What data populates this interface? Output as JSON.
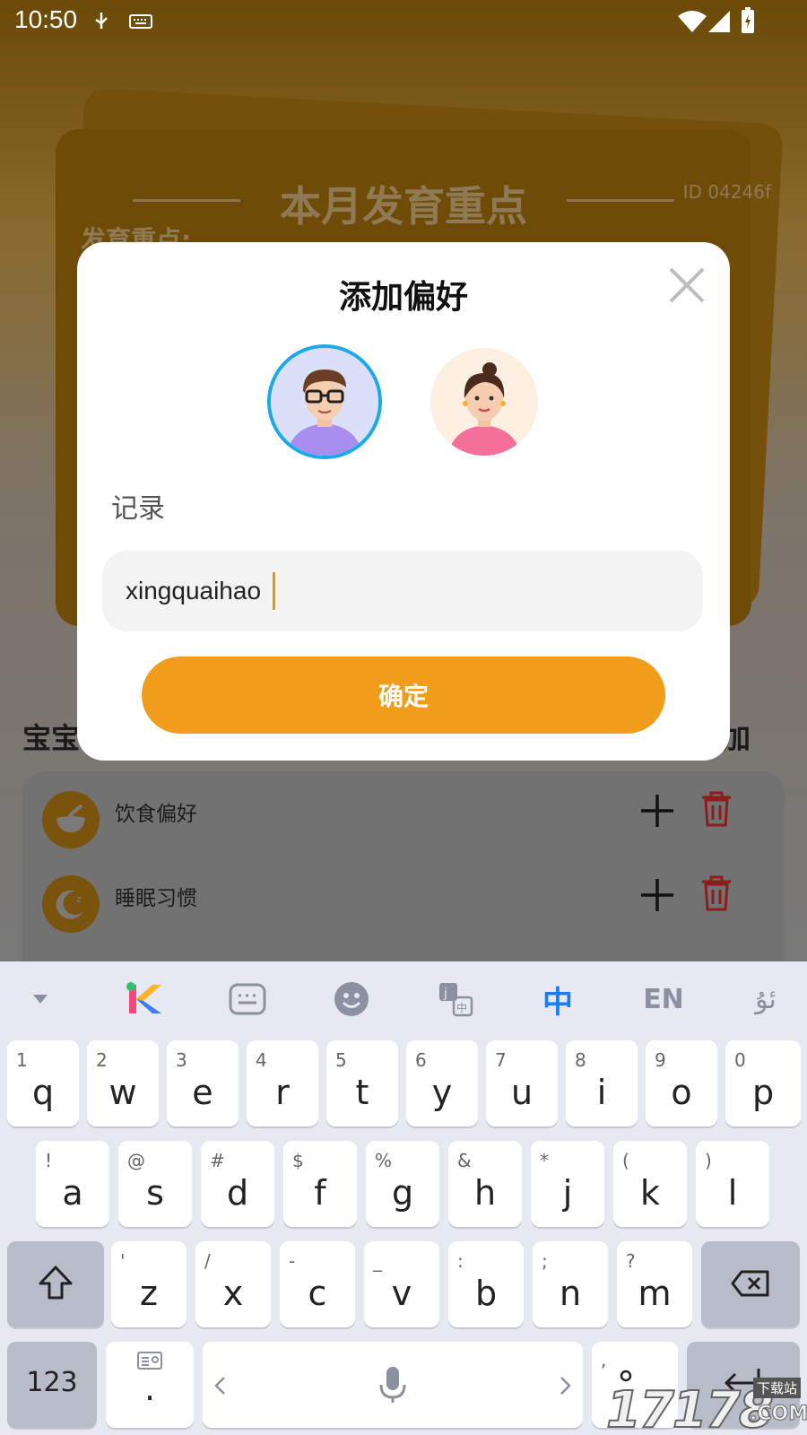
{
  "status_bar": {
    "time": "10:50"
  },
  "background": {
    "card_title": "本月发育重点",
    "card_subtitle": "发育重点:",
    "card_id": "ID 04246f",
    "section_left": "宝宝",
    "section_right": "加",
    "preferences": [
      {
        "label": "饮食偏好",
        "icon": "bowl-icon"
      },
      {
        "label": "睡眠习惯",
        "icon": "moon-icon"
      }
    ]
  },
  "dialog": {
    "title": "添加偏好",
    "avatars": [
      {
        "name": "male-avatar",
        "selected": true
      },
      {
        "name": "female-avatar",
        "selected": false
      }
    ],
    "field_label": "记录",
    "input_value": "xingquaihao",
    "confirm_label": "确定"
  },
  "keyboard": {
    "toolbar": [
      "collapse-icon",
      "kika-logo-icon",
      "keyboard-layout-icon",
      "emoji-icon",
      "translate-icon",
      "中",
      "EN",
      "ئۇ"
    ],
    "row1": [
      {
        "main": "q",
        "sub": "1"
      },
      {
        "main": "w",
        "sub": "2"
      },
      {
        "main": "e",
        "sub": "3"
      },
      {
        "main": "r",
        "sub": "4"
      },
      {
        "main": "t",
        "sub": "5"
      },
      {
        "main": "y",
        "sub": "6"
      },
      {
        "main": "u",
        "sub": "7"
      },
      {
        "main": "i",
        "sub": "8"
      },
      {
        "main": "o",
        "sub": "9"
      },
      {
        "main": "p",
        "sub": "0"
      }
    ],
    "row2": [
      {
        "main": "a",
        "sub": "!"
      },
      {
        "main": "s",
        "sub": "@"
      },
      {
        "main": "d",
        "sub": "#"
      },
      {
        "main": "f",
        "sub": "$"
      },
      {
        "main": "g",
        "sub": "%"
      },
      {
        "main": "h",
        "sub": "&"
      },
      {
        "main": "j",
        "sub": "*"
      },
      {
        "main": "k",
        "sub": "("
      },
      {
        "main": "l",
        "sub": ")"
      }
    ],
    "row3": [
      {
        "main": "z",
        "sub": "'"
      },
      {
        "main": "x",
        "sub": "/"
      },
      {
        "main": "c",
        "sub": "-"
      },
      {
        "main": "v",
        "sub": "_"
      },
      {
        "main": "b",
        "sub": ":"
      },
      {
        "main": "n",
        "sub": ";"
      },
      {
        "main": "m",
        "sub": "?"
      }
    ],
    "num_key": "123",
    "period_key": ".",
    "comma_key": ","
  },
  "watermark": {
    "number": "17178",
    "site": "下载站",
    "domain": ".COM"
  },
  "colors": {
    "accent": "#f29c1c",
    "avatar_ring": "#1aa9ea",
    "delete": "#c0392b"
  }
}
